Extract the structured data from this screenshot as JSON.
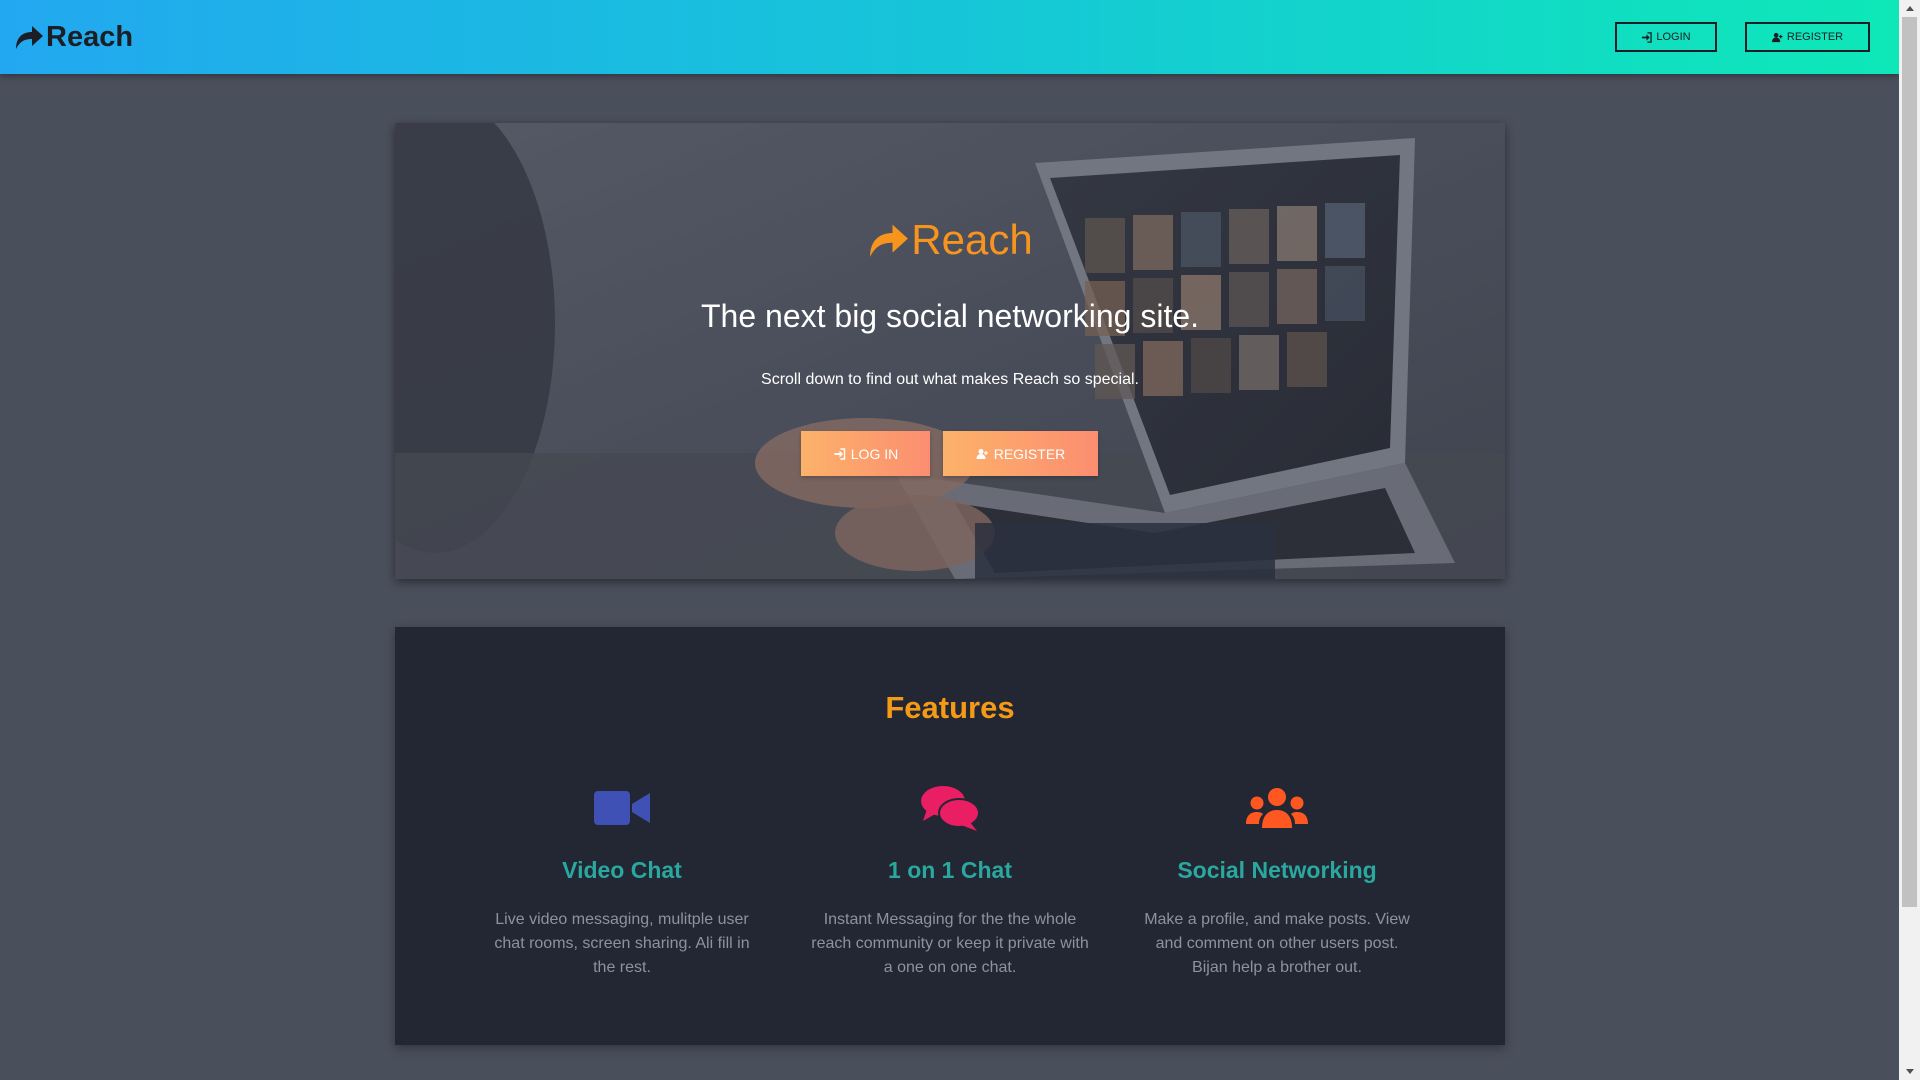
{
  "navbar": {
    "brand": "Reach",
    "login_label": "LOGIN",
    "register_label": "REGISTER"
  },
  "hero": {
    "logo_text": "Reach",
    "title": "The next big social networking site.",
    "subtitle": "Scroll down to find out what makes Reach so special.",
    "login_label": "LOG IN",
    "register_label": "REGISTER"
  },
  "features": {
    "title": "Features",
    "items": [
      {
        "icon": "video-camera-icon",
        "color": "#3f51b5",
        "title": "Video Chat",
        "description": "Live video messaging, mulitple user chat rooms, screen sharing. Ali fill in the rest."
      },
      {
        "icon": "chat-bubbles-icon",
        "color": "#e91e63",
        "title": "1 on 1 Chat",
        "description": "Instant Messaging for the the whole reach community or keep it private with a one on one chat."
      },
      {
        "icon": "users-icon",
        "color": "#ff5722",
        "title": "Social Networking",
        "description": "Make a profile, and make posts. View and comment on other users post. Bijan help a brother out."
      }
    ]
  },
  "colors": {
    "accent": "#f7941d",
    "feature_title": "#2aa8a0",
    "navbar_gradient": [
      "#22a8f0",
      "#0ee8b8"
    ]
  }
}
